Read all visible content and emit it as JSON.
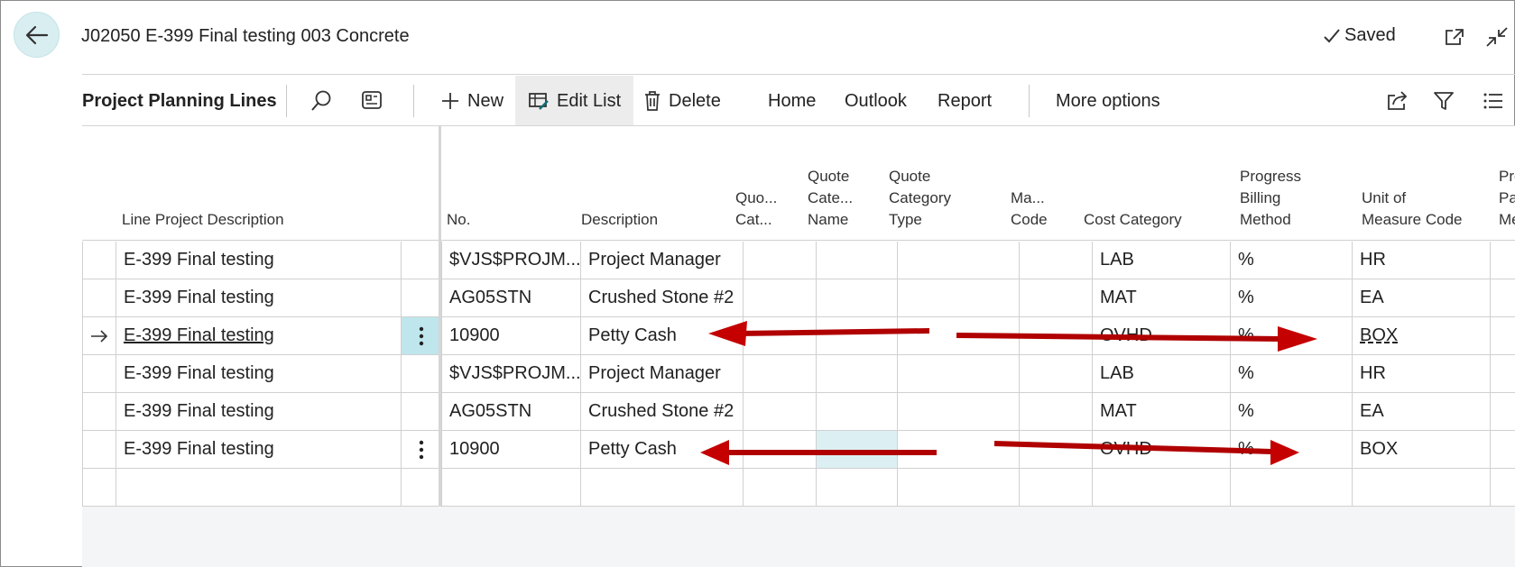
{
  "header": {
    "title": "J02050 E-399 Final testing 003 Concrete",
    "saved_label": "Saved"
  },
  "actionbar": {
    "title": "Project Planning Lines",
    "new_label": "New",
    "edit_list_label": "Edit List",
    "delete_label": "Delete",
    "home_label": "Home",
    "outlook_label": "Outlook",
    "report_label": "Report",
    "more_options_label": "More options"
  },
  "columns": {
    "line_desc": "Line Project Description",
    "no": "No.",
    "description": "Description",
    "quote_cat": "Quo...\nCat...",
    "quote_cat_name": "Quote\nCate...\nName",
    "quote_cat_type": "Quote\nCategory\nType",
    "ma_code": "Ma...\nCode",
    "cost_category": "Cost Category",
    "progress_billing": "Progress\nBilling\nMethod",
    "uom": "Unit of\nMeasure Code",
    "progress_pay": "Pro\nPay\nMe"
  },
  "rows": [
    {
      "line_desc": "E-399 Final testing",
      "no": "$VJS$PROJM...",
      "description": "Project Manager",
      "cost_category": "LAB",
      "progress_billing": "%",
      "uom": "HR"
    },
    {
      "line_desc": "E-399 Final testing",
      "no": "AG05STN",
      "description": "Crushed Stone #2",
      "cost_category": "MAT",
      "progress_billing": "%",
      "uom": "EA"
    },
    {
      "line_desc": "E-399 Final testing",
      "no": "10900",
      "description": "Petty Cash",
      "cost_category": "OVHD",
      "progress_billing": "%",
      "uom": "BOX"
    },
    {
      "line_desc": "E-399 Final testing",
      "no": "$VJS$PROJM...",
      "description": "Project Manager",
      "cost_category": "LAB",
      "progress_billing": "%",
      "uom": "HR"
    },
    {
      "line_desc": "E-399 Final testing",
      "no": "AG05STN",
      "description": "Crushed Stone #2",
      "cost_category": "MAT",
      "progress_billing": "%",
      "uom": "EA"
    },
    {
      "line_desc": "E-399 Final testing",
      "no": "10900",
      "description": "Petty Cash",
      "cost_category": "OVHD",
      "progress_billing": "%",
      "uom": "BOX"
    }
  ],
  "colors": {
    "accent": "#0f6e7a",
    "selected_cell": "#bfe6ec",
    "annotation_arrow": "#b00000"
  }
}
